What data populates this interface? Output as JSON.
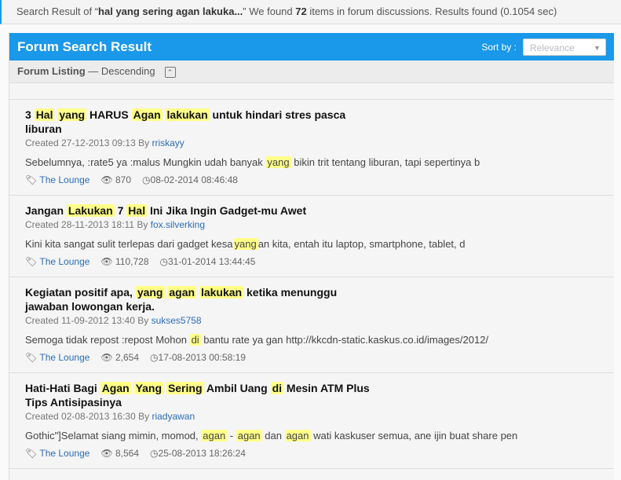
{
  "summary": {
    "prefix": "Search Result of “",
    "query": "hal yang sering agan lakuka...",
    "mid": "” We found ",
    "count": "72",
    "suffix": " items in forum discussions. Results found (0.1054 sec)"
  },
  "header": {
    "title": "Forum Search Result",
    "sort_label": "Sort by :",
    "sort_value": "Relevance"
  },
  "listing": {
    "label": "Forum Listing",
    "order": " — Descending"
  },
  "items": [
    {
      "title": [
        {
          "t": "3 ",
          "h": false
        },
        {
          "t": "Hal",
          "h": true
        },
        {
          "t": " ",
          "h": false
        },
        {
          "t": "yang",
          "h": true
        },
        {
          "t": " HARUS ",
          "h": false
        },
        {
          "t": "Agan",
          "h": true
        },
        {
          "t": " ",
          "h": false
        },
        {
          "t": "lakukan",
          "h": true
        },
        {
          "t": " untuk hindari stres pasca liburan",
          "h": false
        }
      ],
      "created": "Created 27-12-2013 09:13 By ",
      "author": "rriskayy",
      "snippet": [
        {
          "t": "Sebelumnya, :rate5 ya :malus Mungkin udah banyak ",
          "h": false
        },
        {
          "t": "yang",
          "h": true
        },
        {
          "t": " bikin trit tentang liburan, tapi sepertinya b",
          "h": false
        }
      ],
      "forum": "The Lounge",
      "views": "870",
      "last": "08-02-2014 08:46:48"
    },
    {
      "title": [
        {
          "t": "Jangan ",
          "h": false
        },
        {
          "t": "Lakukan",
          "h": true
        },
        {
          "t": " 7 ",
          "h": false
        },
        {
          "t": "Hal",
          "h": true
        },
        {
          "t": " Ini Jika Ingin Gadget-mu Awet",
          "h": false
        }
      ],
      "created": "Created 28-11-2013 18:11 By ",
      "author": "fox.silverking",
      "snippet": [
        {
          "t": "Kini kita sangat sulit terlepas dari gadget kesa",
          "h": false
        },
        {
          "t": "yang",
          "h": true
        },
        {
          "t": "an kita, entah itu laptop, smartphone, tablet, d",
          "h": false
        }
      ],
      "forum": "The Lounge",
      "views": "110,728",
      "last": "31-01-2014 13:44:45"
    },
    {
      "title": [
        {
          "t": "Kegiatan positif apa, ",
          "h": false
        },
        {
          "t": "yang",
          "h": true
        },
        {
          "t": " ",
          "h": false
        },
        {
          "t": "agan",
          "h": true
        },
        {
          "t": " ",
          "h": false
        },
        {
          "t": "lakukan",
          "h": true
        },
        {
          "t": " ketika menunggu jawaban lowongan kerja.",
          "h": false
        }
      ],
      "created": "Created 11-09-2012 13:40 By ",
      "author": "sukses5758",
      "snippet": [
        {
          "t": "Semoga tidak repost :repost Mohon ",
          "h": false
        },
        {
          "t": "di",
          "h": true
        },
        {
          "t": " bantu rate ya gan http://kkcdn-static.kaskus.co.id/images/2012/",
          "h": false
        }
      ],
      "forum": "The Lounge",
      "views": "2,654",
      "last": "17-08-2013 00:58:19"
    },
    {
      "title": [
        {
          "t": "Hati-Hati Bagi ",
          "h": false
        },
        {
          "t": "Agan",
          "h": true
        },
        {
          "t": " ",
          "h": false
        },
        {
          "t": "Yang",
          "h": true
        },
        {
          "t": " ",
          "h": false
        },
        {
          "t": "Sering",
          "h": true
        },
        {
          "t": " Ambil Uang ",
          "h": false
        },
        {
          "t": "di",
          "h": true
        },
        {
          "t": " Mesin ATM Plus Tips Antisipasinya",
          "h": false
        }
      ],
      "created": "Created 02-08-2013 16:30 By ",
      "author": "riadyawan",
      "snippet": [
        {
          "t": "Gothic\"]Selamat siang mimin, momod, ",
          "h": false
        },
        {
          "t": "agan",
          "h": true
        },
        {
          "t": " - ",
          "h": false
        },
        {
          "t": "agan",
          "h": true
        },
        {
          "t": " dan ",
          "h": false
        },
        {
          "t": "agan",
          "h": true
        },
        {
          "t": " wati kaskuser semua, ane ijin buat share pen",
          "h": false
        }
      ],
      "forum": "The Lounge",
      "views": "8,564",
      "last": "25-08-2013 18:26:24"
    }
  ]
}
